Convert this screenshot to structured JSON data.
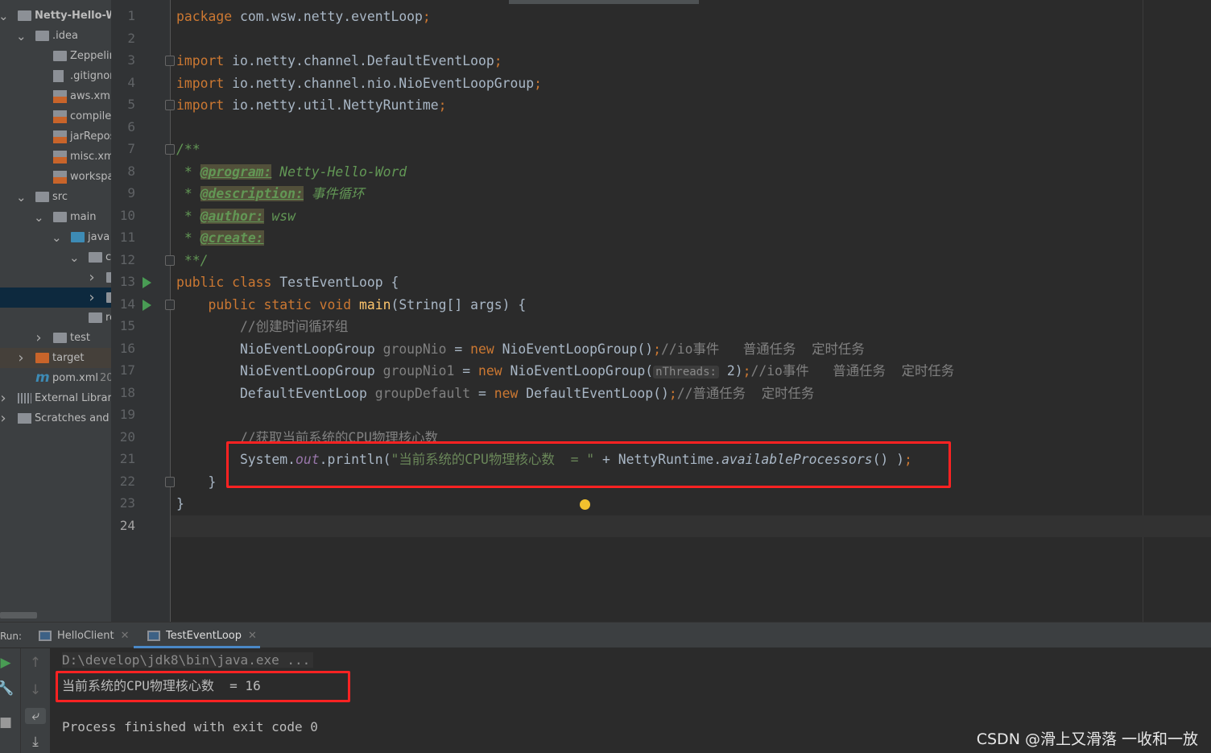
{
  "project_tree": [
    {
      "label": "Netty-Hello-Wo",
      "icon": "project-folder-icon",
      "depth": 0,
      "expanded": true,
      "bold": true
    },
    {
      "label": ".idea",
      "icon": "folder-icon",
      "depth": 1,
      "expanded": true
    },
    {
      "label": "Zeppelin",
      "icon": "folder-icon",
      "depth": 2
    },
    {
      "label": ".gitignore",
      "icon": "ignored-file-icon",
      "depth": 2
    },
    {
      "label": "aws.xml",
      "icon": "xml-file-icon",
      "depth": 2
    },
    {
      "label": "compiler",
      "icon": "xml-file-icon",
      "depth": 2
    },
    {
      "label": "jarRepos",
      "icon": "xml-file-icon",
      "depth": 2
    },
    {
      "label": "misc.xml",
      "icon": "xml-file-icon",
      "depth": 2
    },
    {
      "label": "workspa",
      "icon": "xml-file-icon",
      "depth": 2
    },
    {
      "label": "src",
      "icon": "folder-icon",
      "depth": 1,
      "expanded": true
    },
    {
      "label": "main",
      "icon": "folder-icon",
      "depth": 2,
      "expanded": true
    },
    {
      "label": "java",
      "icon": "source-folder-icon",
      "depth": 3,
      "expanded": true
    },
    {
      "label": "c",
      "icon": "package-icon",
      "depth": 4,
      "expanded": true
    },
    {
      "label": "",
      "icon": "package-icon",
      "depth": 5,
      "collapsed": true
    },
    {
      "label": "",
      "icon": "package-icon",
      "depth": 5,
      "collapsed": true,
      "selected": true
    },
    {
      "label": "reso",
      "icon": "resources-folder-icon",
      "depth": 4
    },
    {
      "label": "test",
      "icon": "folder-icon",
      "depth": 2,
      "collapsed": true
    },
    {
      "label": "target",
      "icon": "excluded-folder-icon",
      "depth": 1,
      "collapsed": true,
      "target": true
    },
    {
      "label": "pom.xml",
      "icon": "maven-icon",
      "depth": 1,
      "suffix": "20"
    },
    {
      "label": "External Librarie",
      "icon": "libraries-icon",
      "depth": 0,
      "collapsed": true
    },
    {
      "label": "Scratches and Co",
      "icon": "scratches-icon",
      "depth": 0,
      "collapsed": true
    }
  ],
  "editor": {
    "line_numbers": [
      "1",
      "2",
      "3",
      "4",
      "5",
      "6",
      "7",
      "8",
      "9",
      "10",
      "11",
      "12",
      "13",
      "14",
      "15",
      "16",
      "17",
      "18",
      "19",
      "20",
      "21",
      "22",
      "23",
      "24"
    ],
    "current_line": "24",
    "run_gutter_lines": [
      "13",
      "14"
    ],
    "fold_lines": [
      "3",
      "5",
      "7",
      "12",
      "14",
      "22"
    ],
    "lines": [
      [
        [
          "package ",
          "kw"
        ],
        [
          "com.wsw.netty.eventLoop",
          ""
        ],
        [
          ";",
          "kw"
        ]
      ],
      [],
      [
        [
          "import ",
          "kw"
        ],
        [
          "io.netty.channel.DefaultEventLoop",
          ""
        ],
        [
          ";",
          "kw"
        ]
      ],
      [
        [
          "import ",
          "kw"
        ],
        [
          "io.netty.channel.nio.NioEventLoopGroup",
          ""
        ],
        [
          ";",
          "kw"
        ]
      ],
      [
        [
          "import ",
          "kw"
        ],
        [
          "io.netty.util.NettyRuntime",
          ""
        ],
        [
          ";",
          "kw"
        ]
      ],
      [],
      [
        [
          "/**",
          "doc"
        ]
      ],
      [
        [
          " * ",
          "doc"
        ],
        [
          "@program:",
          "tag"
        ],
        [
          " Netty-Hello-Word",
          "doc"
        ]
      ],
      [
        [
          " * ",
          "doc"
        ],
        [
          "@description:",
          "tag"
        ],
        [
          " 事件循环",
          "doc"
        ]
      ],
      [
        [
          " * ",
          "doc"
        ],
        [
          "@author:",
          "tag"
        ],
        [
          " wsw",
          "doc"
        ]
      ],
      [
        [
          " * ",
          "doc"
        ],
        [
          "@create:",
          "tag"
        ]
      ],
      [
        [
          " **/",
          "doc"
        ]
      ],
      [
        [
          "public class ",
          "kw"
        ],
        [
          "TestEventLoop {",
          ""
        ]
      ],
      [
        [
          "    public static void ",
          "kw"
        ],
        [
          "main",
          "fn"
        ],
        [
          "(String[] args) {",
          ""
        ]
      ],
      [
        [
          "        //创建时间循环组",
          "cm"
        ]
      ],
      [
        [
          "        NioEventLoopGroup ",
          ""
        ],
        [
          "groupNio",
          "var"
        ],
        [
          " = ",
          ""
        ],
        [
          "new ",
          "kw"
        ],
        [
          "NioEventLoopGroup()",
          ""
        ],
        [
          ";",
          "kw"
        ],
        [
          "//io事件   普通任务  定时任务",
          "cm"
        ]
      ],
      [
        [
          "        NioEventLoopGroup ",
          ""
        ],
        [
          "groupNio1",
          "var"
        ],
        [
          " = ",
          ""
        ],
        [
          "new ",
          "kw"
        ],
        [
          "NioEventLoopGroup(",
          ""
        ],
        [
          "nThreads:",
          "hint"
        ],
        [
          " 2)",
          ""
        ],
        [
          ";",
          "kw"
        ],
        [
          "//io事件   普通任务  定时任务",
          "cm"
        ]
      ],
      [
        [
          "        DefaultEventLoop ",
          ""
        ],
        [
          "groupDefault",
          "var"
        ],
        [
          " = ",
          ""
        ],
        [
          "new ",
          "kw"
        ],
        [
          "DefaultEventLoop()",
          ""
        ],
        [
          ";",
          "kw"
        ],
        [
          "//普通任务  定时任务",
          "cm"
        ]
      ],
      [],
      [
        [
          "        //获取当前系统的CPU物理核心数",
          "cm"
        ]
      ],
      [
        [
          "        System.",
          ""
        ],
        [
          "out",
          "fld"
        ],
        [
          ".println(",
          ""
        ],
        [
          "\"当前系统的CPU物理核心数  = \"",
          "str"
        ],
        [
          " + NettyRuntime.",
          ""
        ],
        [
          "availableProcessors",
          "it"
        ],
        [
          "() )",
          ""
        ],
        [
          ";",
          "kw"
        ]
      ],
      [
        [
          "    }",
          ""
        ]
      ],
      [
        [
          "}",
          ""
        ]
      ],
      []
    ]
  },
  "run_panel": {
    "label": "Run:",
    "tabs": [
      {
        "label": "HelloClient",
        "active": false
      },
      {
        "label": "TestEventLoop",
        "active": true
      }
    ],
    "output": [
      "D:\\develop\\jdk8\\bin\\java.exe ...",
      "当前系统的CPU物理核心数  = 16",
      "",
      "Process finished with exit code 0"
    ]
  },
  "watermark": "CSDN @滑上又滑落 一收和一放",
  "colors": {
    "highlight_box": "#ff2222",
    "keyword": "#cc7832",
    "doc_comment": "#629755",
    "string": "#6a8759"
  }
}
